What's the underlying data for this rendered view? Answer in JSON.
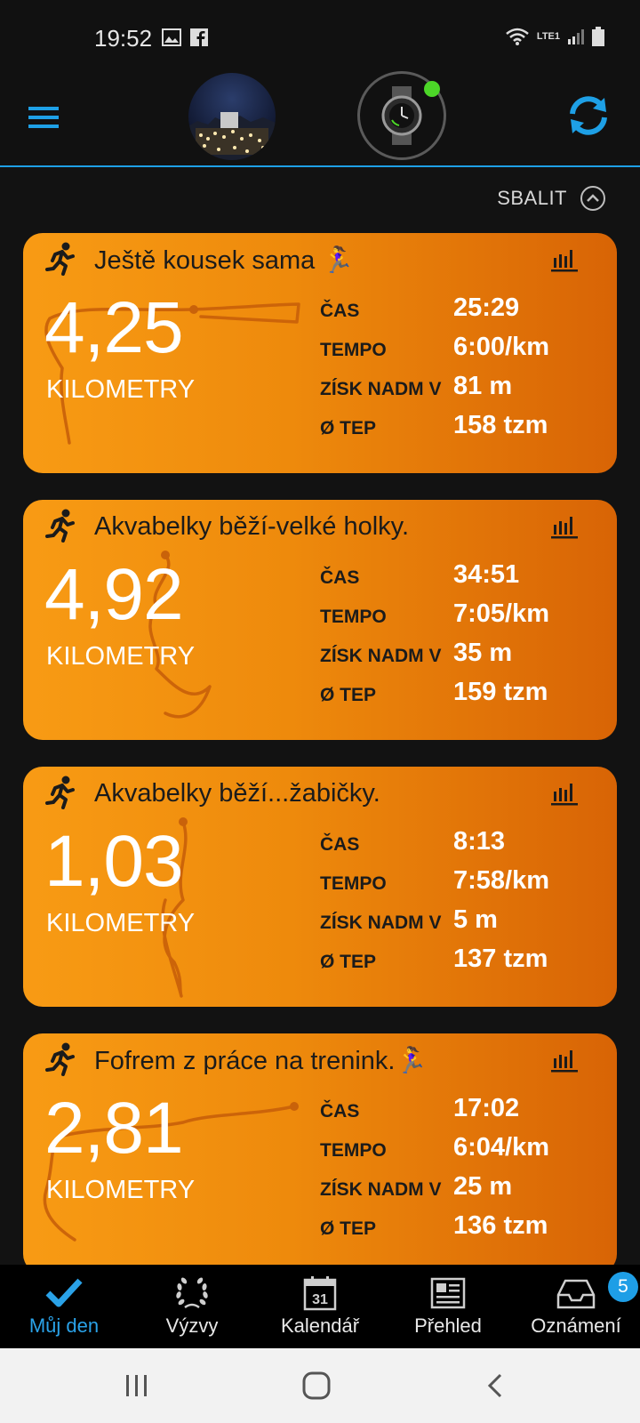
{
  "status_bar": {
    "time": "19:52",
    "network": "LTE1"
  },
  "header": {
    "collapse_label": "SBALIT"
  },
  "labels": {
    "time": "ČAS",
    "pace": "TEMPO",
    "elev": "ZÍSK NADM V",
    "hr": "Ø TEP",
    "unit": "KILOMETRY"
  },
  "activities": [
    {
      "title": "Ještě kousek sama 🏃‍♀️",
      "distance": "4,25",
      "time": "25:29",
      "pace": "6:00/km",
      "elevation": "81 m",
      "heart_rate": "158 tzm"
    },
    {
      "title": "Akvabelky běží-velké holky.",
      "distance": "4,92",
      "time": "34:51",
      "pace": "7:05/km",
      "elevation": "35 m",
      "heart_rate": "159 tzm"
    },
    {
      "title": "Akvabelky běží...žabičky.",
      "distance": "1,03",
      "time": "8:13",
      "pace": "7:58/km",
      "elevation": "5 m",
      "heart_rate": "137 tzm"
    },
    {
      "title": "Fofrem z práce na trenink.🏃‍♀️",
      "distance": "2,81",
      "time": "17:02",
      "pace": "6:04/km",
      "elevation": "25 m",
      "heart_rate": "136 tzm"
    }
  ],
  "bottom_nav": [
    {
      "label": "Můj den",
      "icon": "checkmark-icon",
      "active": true
    },
    {
      "label": "Výzvy",
      "icon": "laurel-icon"
    },
    {
      "label": "Kalendář",
      "icon": "calendar-icon",
      "day": "31"
    },
    {
      "label": "Přehled",
      "icon": "newsfeed-icon"
    },
    {
      "label": "Oznámení",
      "icon": "inbox-icon",
      "badge": "5"
    }
  ],
  "colors": {
    "accent": "#1ea0e6",
    "card_orange": "#f89b14",
    "active_dot": "#4cd628"
  }
}
